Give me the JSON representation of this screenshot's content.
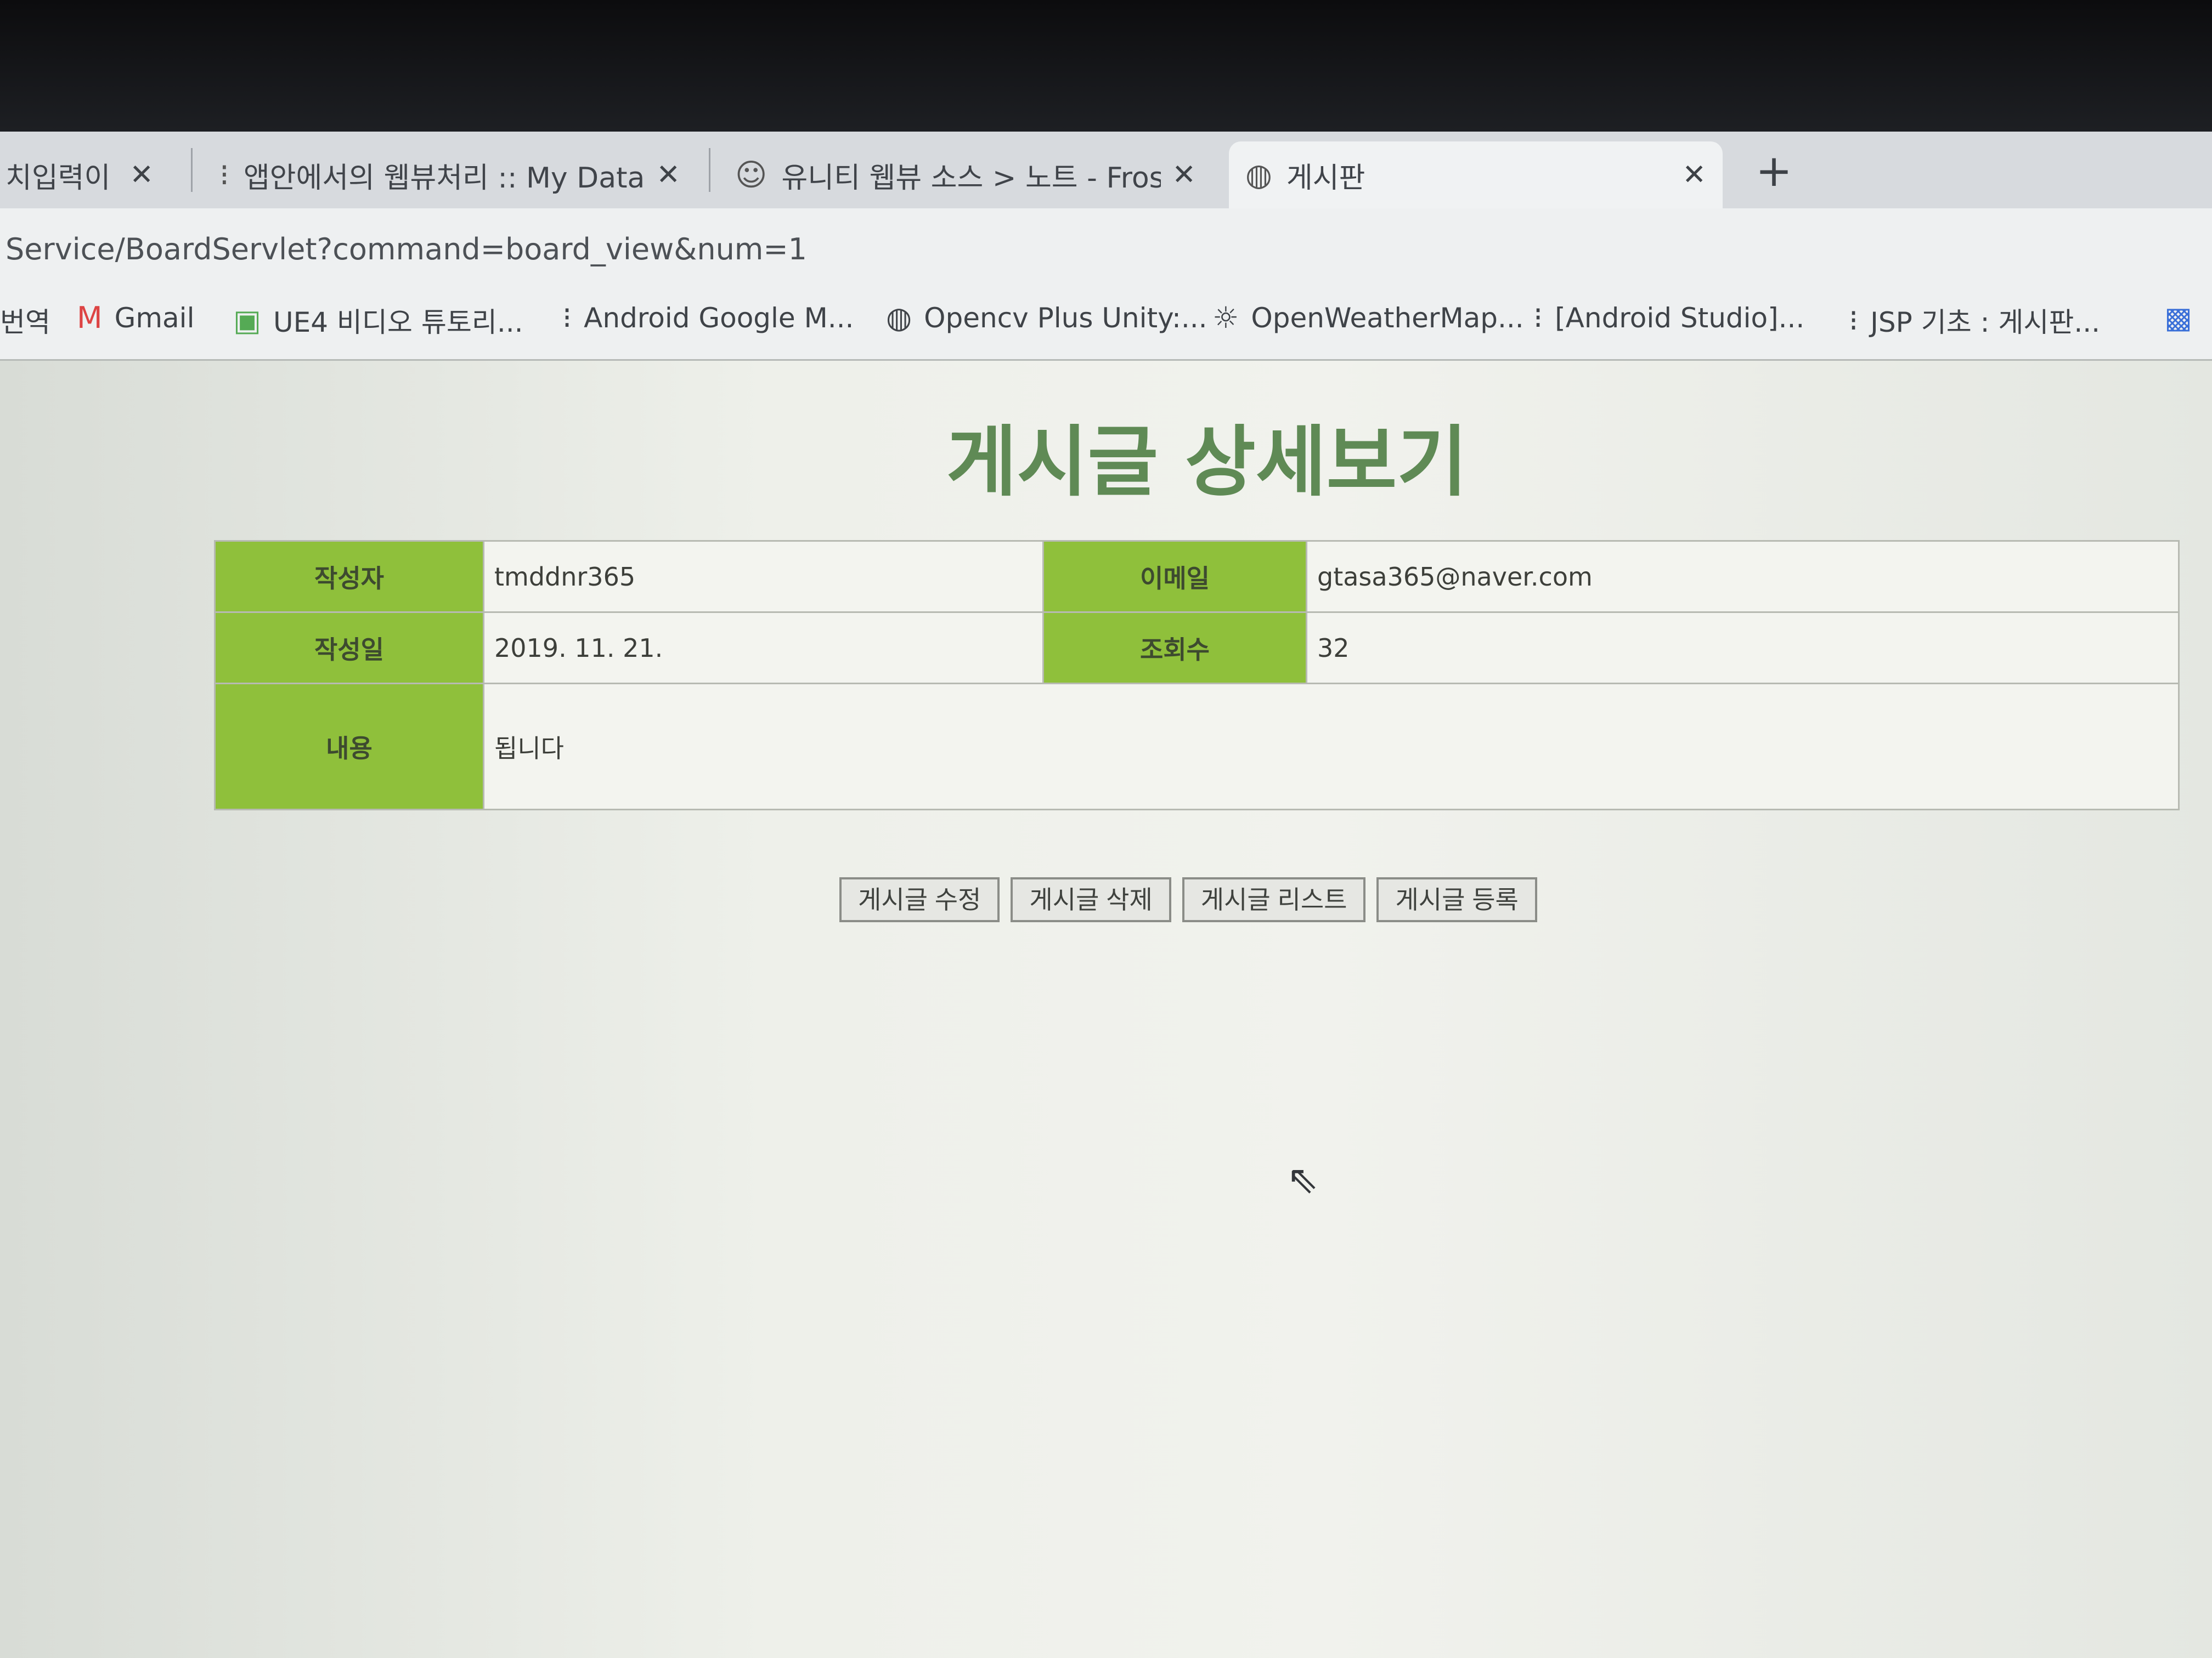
{
  "browser": {
    "tabs": [
      {
        "label": "치입력이",
        "icon": "page-icon"
      },
      {
        "label": "앱안에서의 웹뷰처리 :: My Data",
        "icon": "tistory-icon"
      },
      {
        "label": "유니티 웹뷰 소스 > 노트 - Frost",
        "icon": "cat-icon"
      },
      {
        "label": "게시판",
        "icon": "globe-icon"
      }
    ],
    "new_tab": "+",
    "url": "Service/BoardServlet?command=board_view&num=1",
    "bookmarks": [
      {
        "label": "번역",
        "icon": "page-icon"
      },
      {
        "label": "Gmail",
        "icon": "gmail-icon"
      },
      {
        "label": "UE4 비디오 튜토리...",
        "icon": "ue4-icon"
      },
      {
        "label": "Android Google M...",
        "icon": "tistory-icon"
      },
      {
        "label": "Opencv Plus Unity:...",
        "icon": "globe-icon"
      },
      {
        "label": "OpenWeatherMap...",
        "icon": "weather-icon"
      },
      {
        "label": "[Android Studio]...",
        "icon": "tistory-icon"
      },
      {
        "label": "JSP 기초 : 게시판...",
        "icon": "tistory-icon"
      }
    ]
  },
  "page": {
    "title": "게시글 상세보기",
    "fields": {
      "writer_label": "작성자",
      "writer_value": "tmddnr365",
      "email_label": "이메일",
      "email_value": "gtasa365@naver.com",
      "date_label": "작성일",
      "date_value": "2019. 11. 21.",
      "views_label": "조회수",
      "views_value": "32",
      "content_label": "내용",
      "content_value": "됩니다"
    },
    "buttons": {
      "edit": "게시글 수정",
      "delete": "게시글 삭제",
      "list": "게시글 리스트",
      "write": "게시글 등록"
    }
  },
  "colors": {
    "header_cell": "#8fc03b",
    "title": "#5f8a55"
  }
}
